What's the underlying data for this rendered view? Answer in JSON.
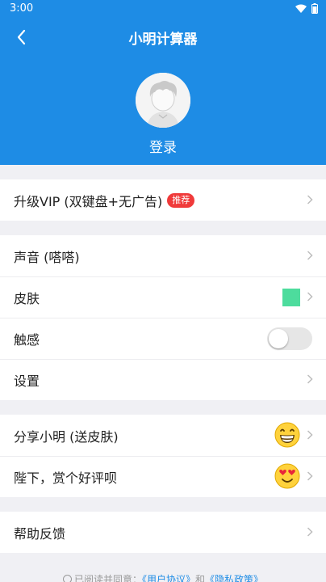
{
  "status_bar": {
    "time": "3:00"
  },
  "header": {
    "title": "小明计算器",
    "login_label": "登录",
    "accent_color": "#1e8ce5"
  },
  "groups": {
    "vip": {
      "label": "升级VIP (双键盘+无广告)",
      "badge": "推荐"
    },
    "settings": {
      "sound": "声音 (嗒嗒)",
      "skin": "皮肤",
      "skin_color": "#4ddc9d",
      "haptic": "触感",
      "haptic_on": false,
      "settings": "设置"
    },
    "social": {
      "share": "分享小明 (送皮肤)",
      "rate": "陛下，赏个好评呗"
    },
    "help": {
      "feedback": "帮助反馈"
    }
  },
  "footer": {
    "agree_prefix": "已阅读并同意：",
    "user_agreement": "《用户协议》",
    "and": "和",
    "privacy_policy": "《隐私政策》"
  },
  "icons": [
    "back-icon",
    "wifi-icon",
    "battery-icon",
    "avatar-icon",
    "chevron-right-icon",
    "grin-emoji-icon",
    "heart-eyes-emoji-icon"
  ]
}
